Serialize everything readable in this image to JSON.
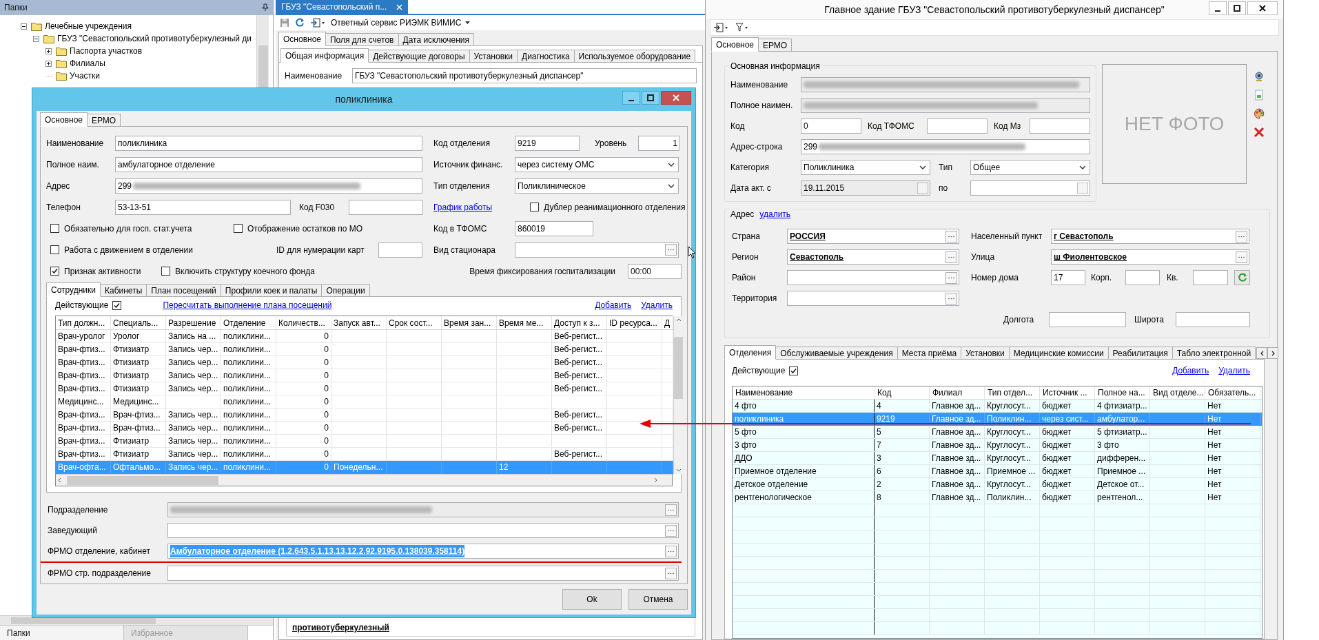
{
  "folders_panel": {
    "title": "Папки",
    "tree": [
      {
        "label": "Лечебные учреждения",
        "kind": "group",
        "expanded": true,
        "children": [
          {
            "label": "ГБУЗ \"Севастопольский противотуберкулезный ди",
            "kind": "group",
            "expanded": true,
            "children": [
              {
                "label": "Паспорта участков",
                "kind": "group",
                "expanded": false
              },
              {
                "label": "Филиалы",
                "kind": "group",
                "expanded": false
              },
              {
                "label": "Участки",
                "kind": "leaf"
              }
            ]
          }
        ]
      }
    ],
    "bottom_tabs": [
      {
        "label": "Папки",
        "selected": true
      },
      {
        "label": "Избранное",
        "selected": false
      }
    ]
  },
  "document": {
    "tab": {
      "label": "ГБУЗ \"Севастопольский п...",
      "selected": true
    },
    "service_menu": "Ответный сервис РИЭМК ВИМИС",
    "tabs": [
      {
        "label": "Основное",
        "selected": true
      },
      {
        "label": "Поля для счетов",
        "selected": false
      },
      {
        "label": "Дата исключения",
        "selected": false
      }
    ],
    "subtabs": [
      {
        "label": "Общая информация",
        "selected": true
      },
      {
        "label": "Действующие договоры",
        "selected": false
      },
      {
        "label": "Установки",
        "selected": false
      },
      {
        "label": "Диагностика",
        "selected": false
      },
      {
        "label": "Используемое оборудование",
        "selected": false
      }
    ],
    "name_field": {
      "label": "Наименование",
      "value": "ГБУЗ \"Севастопольский противотуберкулезный диспансер\""
    },
    "footer_text": "противотуберкулезный"
  },
  "dialog": {
    "title": "поликлиника",
    "tabs": [
      {
        "label": "Основное",
        "selected": true
      },
      {
        "label": "ЕРМО",
        "selected": false
      }
    ],
    "name": {
      "label": "Наименование",
      "value": "поликлиника"
    },
    "full_name": {
      "label": "Полное наим.",
      "value": "амбулаторное отделение"
    },
    "address": {
      "label": "Адрес",
      "value": "299",
      "redacted": true
    },
    "phone": {
      "label": "Телефон",
      "value": "53-13-51"
    },
    "f030": {
      "label": "Код F030"
    },
    "dept_code": {
      "label": "Код отделения",
      "value": "9219"
    },
    "tier": {
      "label": "Уровень",
      "value": "1"
    },
    "funding": {
      "label": "Источник финанс.",
      "value": "через систему ОМС"
    },
    "dept_type": {
      "label": "Тип отделения",
      "value": "Поликлиническое"
    },
    "schedule_link": "График работы",
    "checkboxes": [
      {
        "label": "Обязательно для госп. стат.учета",
        "checked": false
      },
      {
        "label": "Отображение остатков по МО",
        "checked": false
      },
      {
        "label": "Работа с движением в отделении",
        "checked": false
      },
      {
        "label": "Признак активности",
        "checked": true
      },
      {
        "label": "Включить структуру коечного фонда",
        "checked": false
      },
      {
        "label": "Дублер реанимационного отделения",
        "checked": false
      }
    ],
    "card_id": {
      "label": "ID для нумерации карт"
    },
    "tfoms_code": {
      "label": "Код в ТФОМС",
      "value": "860019"
    },
    "hospital_type": {
      "label": "Вид стационара"
    },
    "fix_time": {
      "label": "Время фиксирования госпитализации",
      "value": "00:00"
    },
    "inner_tabs": [
      {
        "label": "Сотрудники",
        "selected": true
      },
      {
        "label": "Кабинеты",
        "selected": false
      },
      {
        "label": "План посещений",
        "selected": false
      },
      {
        "label": "Профили коек и палаты",
        "selected": false
      },
      {
        "label": "Операции",
        "selected": false
      }
    ],
    "active_filter": {
      "label": "Действующие",
      "checked": true
    },
    "recalc_link": "Пересчитать выполнение плана посещений",
    "actions": [
      "Добавить",
      "Удалить"
    ],
    "table": {
      "columns": [
        "Тип должн...",
        "Специаль...",
        "Разрешение",
        "Отделение",
        "Количеств...",
        "Запуск авт...",
        "Срок сост...",
        "Время зан...",
        "Время ме...",
        "Доступ к з...",
        "ID ресурса...",
        "Д"
      ],
      "rows": [
        {
          "selected": false,
          "cells": [
            "Врач-уролог",
            "Уролог",
            "Запись на ...",
            "поликлини...",
            "0",
            null,
            null,
            null,
            null,
            "Веб-регист...",
            null
          ]
        },
        {
          "selected": false,
          "cells": [
            "Врач-фтиз...",
            "Фтизиатр",
            "Запись чер...",
            "поликлини...",
            "0",
            null,
            null,
            null,
            null,
            "Веб-регист...",
            null
          ]
        },
        {
          "selected": false,
          "cells": [
            "Врач-фтиз...",
            "Фтизиатр",
            "Запись чер...",
            "поликлини...",
            "0",
            null,
            null,
            null,
            null,
            "Веб-регист...",
            null
          ]
        },
        {
          "selected": false,
          "cells": [
            "Врач-фтиз...",
            "Фтизиатр",
            "Запись чер...",
            "поликлини...",
            "0",
            null,
            null,
            null,
            null,
            "Веб-регист...",
            null
          ]
        },
        {
          "selected": false,
          "cells": [
            "Врач-фтиз...",
            "Фтизиатр",
            "Запись чер...",
            "поликлини...",
            "0",
            null,
            null,
            null,
            null,
            "Веб-регист...",
            null
          ]
        },
        {
          "selected": false,
          "cells": [
            "Медицинс...",
            "Медицинс...",
            null,
            "поликлини...",
            "0",
            null,
            null,
            null,
            null,
            null,
            null
          ]
        },
        {
          "selected": false,
          "cells": [
            "Врач-фтиз...",
            "Врач-фтиз...",
            "Запись чер...",
            "поликлини...",
            "0",
            null,
            null,
            null,
            null,
            "Веб-регист...",
            null
          ]
        },
        {
          "selected": false,
          "cells": [
            "Врач-фтиз...",
            "Врач-фтиз...",
            "Запись чер...",
            "поликлини...",
            "0",
            null,
            null,
            null,
            null,
            "Веб-регист...",
            null
          ]
        },
        {
          "selected": false,
          "cells": [
            "Врач-фтиз...",
            "Фтизиатр",
            "Запись чер...",
            "поликлини...",
            "0",
            null,
            null,
            null,
            null,
            null,
            null
          ]
        },
        {
          "selected": false,
          "cells": [
            "Врач-фтиз...",
            "Фтизиатр",
            "Запись чер...",
            "поликлини...",
            "0",
            null,
            null,
            null,
            null,
            "Веб-регист...",
            null
          ]
        },
        {
          "selected": true,
          "cells": [
            "Врач-офта...",
            "Офтальмо...",
            "Запись чер...",
            "поликлини...",
            "0",
            "Понедельн...",
            null,
            null,
            "12",
            null,
            null
          ]
        }
      ]
    },
    "bottom_fields": [
      {
        "label": "Подразделение",
        "redacted": true,
        "disabled": true
      },
      {
        "label": "Заведующий",
        "disabled": false
      },
      {
        "label": "ФРМО отделение, кабинет",
        "value": "Амбулаторное отделение (1.2.643.5.1.13.13.12.2.92.9195.0.138039.358114)",
        "highlighted": true
      },
      {
        "label": "ФРМО стр. подразделение",
        "disabled": false
      }
    ],
    "buttons": [
      "Ok",
      "Отмена"
    ]
  },
  "building_window": {
    "title": "Главное здание ГБУЗ \"Севастопольский противотуберкулезный диспансер\"",
    "tabs": [
      {
        "label": "Основное",
        "selected": true
      },
      {
        "label": "ЕРМО",
        "selected": false
      }
    ],
    "info_group": {
      "title": "Основная информация",
      "name": {
        "label": "Наименование",
        "redacted": true,
        "disabled": true
      },
      "full_name": {
        "label": "Полное наимен.",
        "redacted": true,
        "disabled": true
      },
      "code": {
        "label": "Код",
        "value": "0"
      },
      "tfoms": {
        "label": "Код ТФОМС"
      },
      "mz": {
        "label": "Код Мз"
      },
      "address_line": {
        "label": "Адрес-строка",
        "value": "299",
        "redacted": true
      },
      "category": {
        "label": "Категория",
        "value": "Поликлиника"
      },
      "type": {
        "label": "Тип",
        "value": "Общее"
      },
      "date_from": {
        "label": "Дата акт. с",
        "value": "19.11.2015",
        "disabled": true
      },
      "date_to": {
        "label": "по",
        "disabled": false
      }
    },
    "photo_placeholder": "НЕТ ФОТО",
    "address_group": {
      "title": "Адрес",
      "delete_link": "удалить",
      "country": {
        "label": "Страна",
        "value": "РОССИЯ"
      },
      "region": {
        "label": "Регион",
        "value": "Севастополь"
      },
      "district": {
        "label": "Район"
      },
      "territory": {
        "label": "Территория"
      },
      "locality": {
        "label": "Населенный пункт",
        "value": "г Севастополь"
      },
      "street": {
        "label": "Улица",
        "value": "ш Фиолентовское"
      },
      "house": {
        "label": "Номер дома",
        "value": "17"
      },
      "building": {
        "label": "Корп."
      },
      "apartment": {
        "label": "Кв."
      },
      "longitude": {
        "label": "Долгота"
      },
      "latitude": {
        "label": "Широта"
      }
    },
    "bottom_tabs": [
      {
        "label": "Отделения",
        "selected": true
      },
      {
        "label": "Обслуживаемые учреждения",
        "selected": false
      },
      {
        "label": "Места приёма",
        "selected": false
      },
      {
        "label": "Установки",
        "selected": false
      },
      {
        "label": "Медицинские комиссии",
        "selected": false
      },
      {
        "label": "Реабилитация",
        "selected": false
      },
      {
        "label": "Табло электронной",
        "selected": false
      }
    ],
    "active_filter": {
      "label": "Действующие",
      "checked": true
    },
    "actions": [
      "Добавить",
      "Удалить"
    ],
    "table": {
      "columns": [
        "Наименование",
        "Код",
        "Филиал",
        "Тип отдел...",
        "Источник ...",
        "Полное на...",
        "Вид отделе...",
        "Обязатель..."
      ],
      "rows": [
        {
          "selected": false,
          "cells": [
            "4 фто",
            "4",
            "Главное зд...",
            "Круглосут...",
            "бюджет",
            "4 фтизиатр...",
            null,
            "Нет"
          ]
        },
        {
          "selected": true,
          "cells": [
            "поликлиника",
            "9219",
            "Главное зд...",
            "Поликлин...",
            "через сист...",
            "амбулатор...",
            null,
            "Нет"
          ]
        },
        {
          "selected": false,
          "cells": [
            "5 фто",
            "5",
            "Главное зд...",
            "Круглосут...",
            "бюджет",
            "5 фтизиатр...",
            null,
            "Нет"
          ]
        },
        {
          "selected": false,
          "cells": [
            "3 фто",
            "7",
            "Главное зд...",
            "Круглосут...",
            "бюджет",
            "3 фто",
            null,
            "Нет"
          ]
        },
        {
          "selected": false,
          "cells": [
            "ДДО",
            "3",
            "Главное зд...",
            "Круглосут...",
            "бюджет",
            "дифферен...",
            null,
            "Нет"
          ]
        },
        {
          "selected": false,
          "cells": [
            "Приемное отделение",
            "6",
            "Главное зд...",
            "Приемное ...",
            "бюджет",
            "Приемное ...",
            null,
            "Нет"
          ]
        },
        {
          "selected": false,
          "cells": [
            "Детское отделение",
            "2",
            "Главное зд...",
            "Круглосут...",
            "бюджет",
            "Детское от...",
            null,
            "Нет"
          ]
        },
        {
          "selected": false,
          "cells": [
            "рентгенологическое",
            "8",
            "Главное зд...",
            "Поликлин...",
            "бюджет",
            "рентгенол...",
            null,
            "Нет"
          ]
        }
      ]
    }
  }
}
